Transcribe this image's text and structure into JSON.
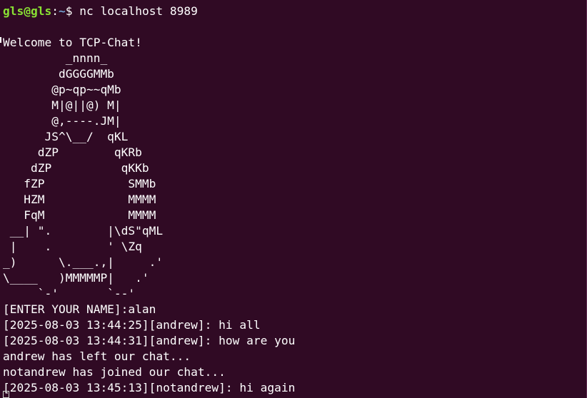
{
  "prompt": {
    "user_host": "gls@gls",
    "separator": ":",
    "path": "~",
    "symbol": "$ ",
    "command": "nc localhost 8989"
  },
  "output_lines": [
    "",
    "Welcome to TCP-Chat!",
    "         _nnnn_",
    "        dGGGGMMb",
    "       @p~qp~~qMb",
    "       M|@||@) M|",
    "       @,----.JM|",
    "      JS^\\__/  qKL",
    "     dZP        qKRb",
    "    dZP          qKKb",
    "   fZP            SMMb",
    "   HZM            MMMM",
    "   FqM            MMMM",
    " __| \".        |\\dS\"qML",
    " |    .        ' \\Zq",
    "_)      \\.___.,|     .'",
    "\\____   )MMMMMP|   .'",
    "     `-'       `--'",
    "[ENTER YOUR NAME]:alan",
    "[2025-08-03 13:44:25][andrew]: hi all",
    "[2025-08-03 13:44:31][andrew]: how are you",
    "andrew has left our chat...",
    "notandrew has joined our chat...",
    "[2025-08-03 13:45:13][notandrew]: hi again"
  ]
}
